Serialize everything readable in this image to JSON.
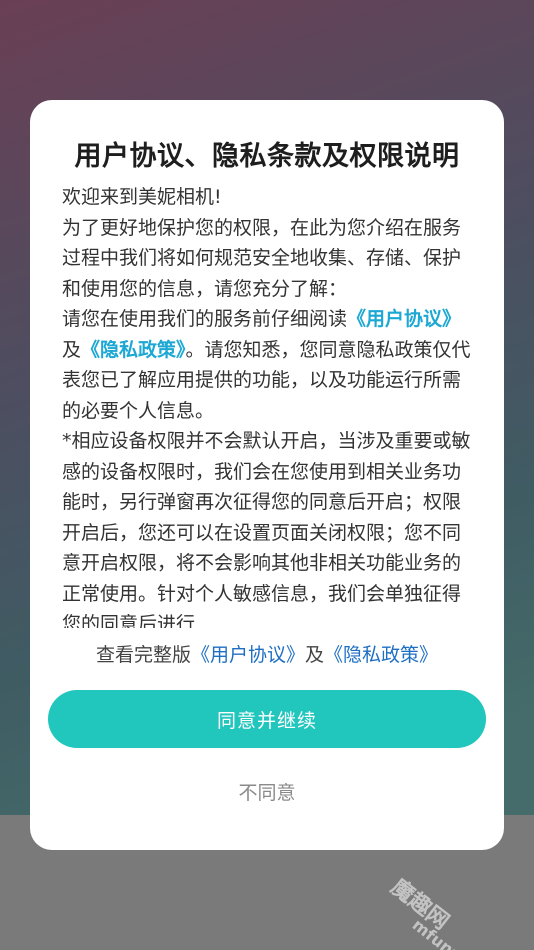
{
  "dialog": {
    "title": "用户协议、隐私条款及权限说明",
    "greeting": "欢迎来到美妮相机!",
    "para1": "为了更好地保护您的权限，在此为您介绍在服务过程中我们将如何规范安全地收集、存储、保护和使用您的信息，请您充分了解：",
    "para2_prefix": "请您在使用我们的服务前仔细阅读",
    "link_user_agreement": "《用户协议》",
    "para2_and": "及",
    "link_privacy_policy": "《隐私政策》",
    "para2_suffix": "。请您知悉，您同意隐私政策仅代表您已了解应用提供的功能，以及功能运行所需的必要个人信息。",
    "para3": "*相应设备权限并不会默认开启，当涉及重要或敏感的设备权限时，我们会在您使用到相关业务功能时，另行弹窗再次征得您的同意后开启；权限开启后，您还可以在设置页面关闭权限；您不同意开启权限，将不会影响其他非相关功能业务的正常使用。针对个人敏感信息，我们会单独征得您的同意后进行",
    "view_full_prefix": "查看完整版",
    "view_full_user_agreement": "《用户协议》",
    "view_full_and": "及",
    "view_full_privacy_policy": "《隐私政策》",
    "agree_label": "同意并继续",
    "disagree_label": "不同意"
  },
  "watermark": {
    "main": "mfunz.com",
    "brand": "魔趣网"
  },
  "colors": {
    "accent": "#21c6bd",
    "link": "#1da8d4",
    "link_footer": "#1e6fc4"
  }
}
